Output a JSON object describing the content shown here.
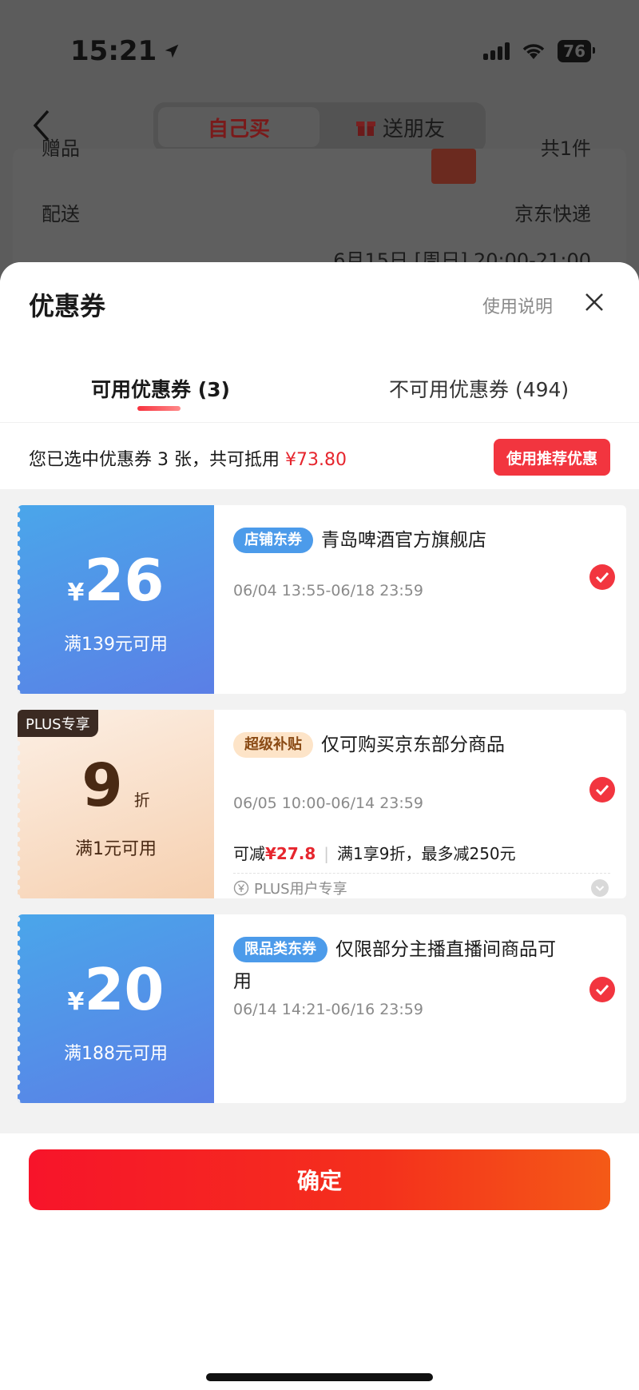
{
  "status": {
    "time": "15:21",
    "battery": "76"
  },
  "nav": {
    "tab_self": "自己买",
    "tab_gift": "送朋友"
  },
  "background": {
    "row1_label": "赠品",
    "row1_value": "共1件",
    "row2_label": "配送",
    "row2_value": "京东快递",
    "row3_value": "6月15日 [周日] 20:00-21:00"
  },
  "sheet": {
    "title": "优惠券",
    "help": "使用说明",
    "tabs": [
      {
        "label": "可用优惠券 (3)",
        "active": true
      },
      {
        "label": "不可用优惠券 (494)",
        "active": false
      }
    ],
    "summary_prefix": "您已选中优惠券 3 张，共可抵用 ",
    "summary_amount": "¥73.80",
    "recommend_btn": "使用推荐优惠"
  },
  "coupons": [
    {
      "currency": "¥",
      "amount": "26",
      "condition": "满139元可用",
      "badge": "店铺东券",
      "title": "青岛啤酒官方旗舰店",
      "validity": "06/04 13:55-06/18 23:59",
      "selected": true
    },
    {
      "plus_tag": "PLUS专享",
      "discount": "9",
      "discount_unit": "折",
      "condition": "满1元可用",
      "badge": "超级补贴",
      "title": "仅可购买京东部分商品",
      "validity": "06/05 10:00-06/14 23:59",
      "detail_prefix": "可减",
      "detail_amount": "¥27.8",
      "detail_rule": "满1享9折，最多减250元",
      "note": "PLUS用户专享",
      "selected": true
    },
    {
      "currency": "¥",
      "amount": "20",
      "condition": "满188元可用",
      "badge": "限品类东券",
      "title": "仅限部分主播直播间商品可用",
      "validity": "06/14 14:21-06/16 23:59",
      "selected": true
    }
  ],
  "footer": {
    "confirm": "确定"
  },
  "colors": {
    "accent_red": "#f2353f",
    "coupon_blue": "#4c9bea",
    "plus_bg": "#f6d0b0"
  }
}
